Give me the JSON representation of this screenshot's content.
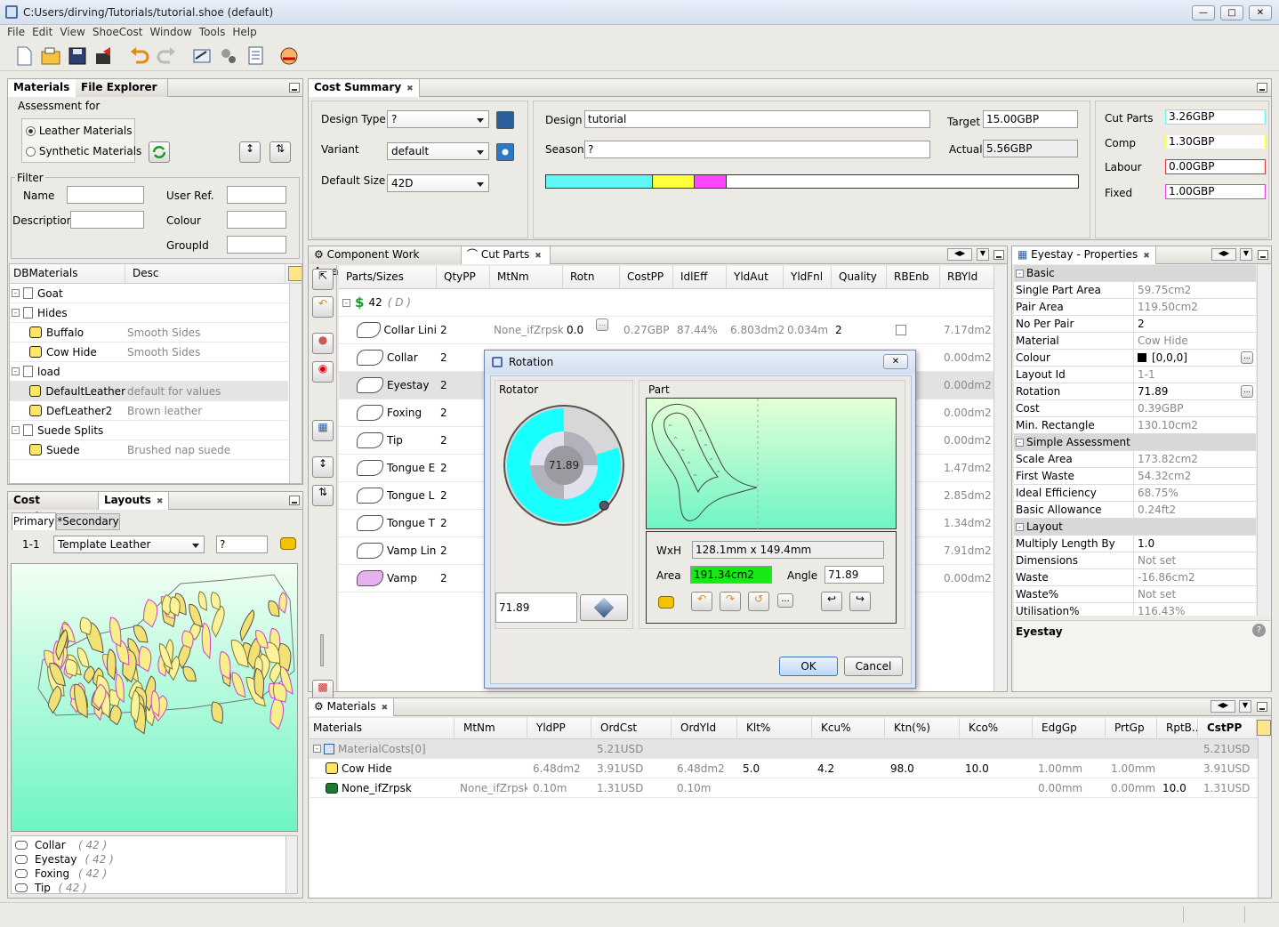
{
  "app": {
    "title": "C:Users/dirving/Tutorials/tutorial.shoe (default)"
  },
  "menu": [
    "File",
    "Edit",
    "View",
    "ShoeCost",
    "Window",
    "Tools",
    "Help"
  ],
  "materials_panel": {
    "tabs": [
      "Materials",
      "File Explorer"
    ],
    "assessment_label": "Assessment for",
    "radio": [
      "Leather Materials",
      "Synthetic Materials"
    ],
    "filter_label": "Filter",
    "filter": {
      "name": "Name",
      "description": "Description",
      "user_ref": "User Ref.",
      "colour": "Colour",
      "group_id": "GroupId"
    },
    "tree_headers": [
      "DBMaterials",
      "Desc"
    ],
    "tree": [
      {
        "label": "Goat",
        "desc": "",
        "level": 0,
        "type": "folder"
      },
      {
        "label": "Hides",
        "desc": "",
        "level": 0,
        "type": "folder"
      },
      {
        "label": "Buffalo",
        "desc": "Smooth Sides",
        "level": 1,
        "type": "hide"
      },
      {
        "label": "Cow Hide",
        "desc": "Smooth Sides",
        "level": 1,
        "type": "hide"
      },
      {
        "label": "load",
        "desc": "",
        "level": 0,
        "type": "folder"
      },
      {
        "label": "DefaultLeather",
        "desc": "default for values",
        "level": 1,
        "type": "hide"
      },
      {
        "label": "DefLeather2",
        "desc": "Brown leather",
        "level": 1,
        "type": "hide"
      },
      {
        "label": "Suede Splits",
        "desc": "",
        "level": 0,
        "type": "folder"
      },
      {
        "label": "Suede",
        "desc": "Brushed nap suede",
        "level": 1,
        "type": "hide"
      }
    ]
  },
  "layouts_panel": {
    "tabs": [
      "Cost Explorer",
      "Layouts"
    ],
    "subtabs": [
      "Primary",
      "*Secondary"
    ],
    "layout_id": "1-1",
    "template": "Template Leather",
    "question": "?",
    "parts_list": [
      {
        "name": "Collar",
        "size": "( 42 )"
      },
      {
        "name": "Eyestay",
        "size": "( 42 )"
      },
      {
        "name": "Foxing",
        "size": "( 42 )"
      },
      {
        "name": "Tip",
        "size": "( 42 )"
      }
    ]
  },
  "cost_summary": {
    "tab": "Cost Summary",
    "design_type_label": "Design Type",
    "design_type": "?",
    "variant_label": "Variant",
    "variant": "default",
    "default_size_label": "Default Size",
    "default_size": "42D",
    "design_label": "Design",
    "design": "tutorial",
    "season_label": "Season",
    "season": "?",
    "target_label": "Target",
    "target": "15.00GBP",
    "actual_label": "Actual",
    "actual": "5.56GBP",
    "bar": [
      {
        "color": "#5ff6f6",
        "fraction": 0.2
      },
      {
        "color": "#ffff3a",
        "fraction": 0.08
      },
      {
        "color": "#ff44ff",
        "fraction": 0.06
      }
    ],
    "cut_parts_label": "Cut Parts",
    "cut_parts": "3.26GBP",
    "comp_label": "Comp",
    "comp": "1.30GBP",
    "labour_label": "Labour",
    "labour": "0.00GBP",
    "fixed_label": "Fixed",
    "fixed": "1.00GBP"
  },
  "cut_parts": {
    "tabs": [
      "Component Work Area",
      "Cut Parts"
    ],
    "headers": [
      "Parts/Sizes",
      "QtyPP",
      "MtNm",
      "Rotn",
      "CostPP",
      "IdlEff",
      "YldAut",
      "YldFnl",
      "Quality",
      "RBEnb",
      "RBYld"
    ],
    "group": {
      "size": "42",
      "size_note": "( D )"
    },
    "rows": [
      {
        "name": "Collar Lini",
        "qty": "2",
        "mtnm": "None_ifZrpsk",
        "rotn": "0.0",
        "cost": "0.27GBP",
        "idl": "87.44%",
        "yldaut": "6.803dm2",
        "yldfnl": "0.034m",
        "quality": "2",
        "rbyld": "7.17dm2"
      },
      {
        "name": "Collar",
        "qty": "2",
        "rbyld": "0.00dm2"
      },
      {
        "name": "Eyestay",
        "qty": "2",
        "rbyld": "0.00dm2"
      },
      {
        "name": "Foxing",
        "qty": "2",
        "rbyld": "0.00dm2"
      },
      {
        "name": "Tip",
        "qty": "2",
        "rbyld": "0.00dm2"
      },
      {
        "name": "Tongue E",
        "qty": "2",
        "rbyld": "1.47dm2"
      },
      {
        "name": "Tongue L",
        "qty": "2",
        "rbyld": "2.85dm2"
      },
      {
        "name": "Tongue T",
        "qty": "2",
        "rbyld": "1.34dm2"
      },
      {
        "name": "Vamp Lin",
        "qty": "2",
        "rbyld": "7.91dm2"
      },
      {
        "name": "Vamp",
        "qty": "2",
        "rbyld": "0.00dm2"
      }
    ]
  },
  "rotation_dialog": {
    "title": "Rotation",
    "rotator_label": "Rotator",
    "part_label": "Part",
    "dial_value": "71.89",
    "rotation": 0.1997,
    "value": "71.89",
    "wxh_label": "WxH",
    "wxh": "128.1mm x 149.4mm",
    "area_label": "Area",
    "area": "191.34cm2",
    "angle_label": "Angle",
    "angle": "71.89",
    "ellipsis": "...",
    "ok": "OK",
    "cancel": "Cancel"
  },
  "properties": {
    "tab": "Eyestay - Properties",
    "rows": [
      {
        "section": "Basic"
      },
      {
        "k": "Single Part Area",
        "v": "59.75cm2",
        "grey": true
      },
      {
        "k": "Pair Area",
        "v": "119.50cm2",
        "grey": true
      },
      {
        "k": "No Per Pair",
        "v": "2"
      },
      {
        "k": "Material",
        "v": "Cow Hide",
        "grey": true
      },
      {
        "k": "Colour",
        "v": "[0,0,0]",
        "swatch": true,
        "btn": true
      },
      {
        "k": "Layout Id",
        "v": "1-1",
        "grey": true
      },
      {
        "k": "Rotation",
        "v": "71.89",
        "btn": true
      },
      {
        "k": "Cost",
        "v": "0.39GBP",
        "grey": true
      },
      {
        "k": "Min. Rectangle",
        "v": "130.10cm2",
        "grey": true
      },
      {
        "section": "Simple Assessment"
      },
      {
        "k": "Scale Area",
        "v": "173.82cm2",
        "grey": true
      },
      {
        "k": "First Waste",
        "v": "54.32cm2",
        "grey": true
      },
      {
        "k": "Ideal Efficiency",
        "v": "68.75%",
        "grey": true
      },
      {
        "k": "Basic Allowance",
        "v": "0.24ft2",
        "grey": true
      },
      {
        "section": "Layout"
      },
      {
        "k": "Multiply Length By",
        "v": "1.0"
      },
      {
        "k": "Dimensions",
        "v": "Not set",
        "grey": true
      },
      {
        "k": "Waste",
        "v": "-16.86cm2",
        "grey": true
      },
      {
        "k": "Waste%",
        "v": "Not set",
        "grey": true
      },
      {
        "k": "Utilisation%",
        "v": "116.43%",
        "grey": true
      }
    ],
    "footer": "Eyestay"
  },
  "materials_table": {
    "tab": "Materials",
    "headers": [
      "Materials",
      "MtNm",
      "YldPP",
      "OrdCst",
      "OrdYld",
      "Klt%",
      "Kcu%",
      "Ktn(%)",
      "Kco%",
      "EdgGp",
      "PrtGp",
      "RptB...",
      "CstPP"
    ],
    "rows": [
      {
        "cells": [
          "MaterialCosts[0]",
          "",
          "",
          "5.21USD",
          "",
          "",
          "",
          "",
          "",
          "",
          "",
          "",
          "5.21USD"
        ],
        "grey": true,
        "icon": "group"
      },
      {
        "cells": [
          "Cow Hide",
          "",
          "6.48dm2",
          "3.91USD",
          "6.48dm2",
          "5.0",
          "4.2",
          "98.0",
          "10.0",
          "1.00mm",
          "1.00mm",
          "",
          "3.91USD"
        ],
        "icon": "hide"
      },
      {
        "cells": [
          "None_ifZrpsk",
          "None_ifZrpsk",
          "0.10m",
          "1.31USD",
          "0.10m",
          "",
          "",
          "",
          "",
          "0.00mm",
          "0.00mm",
          "10.0",
          "1.31USD"
        ],
        "icon": "roll"
      }
    ]
  }
}
